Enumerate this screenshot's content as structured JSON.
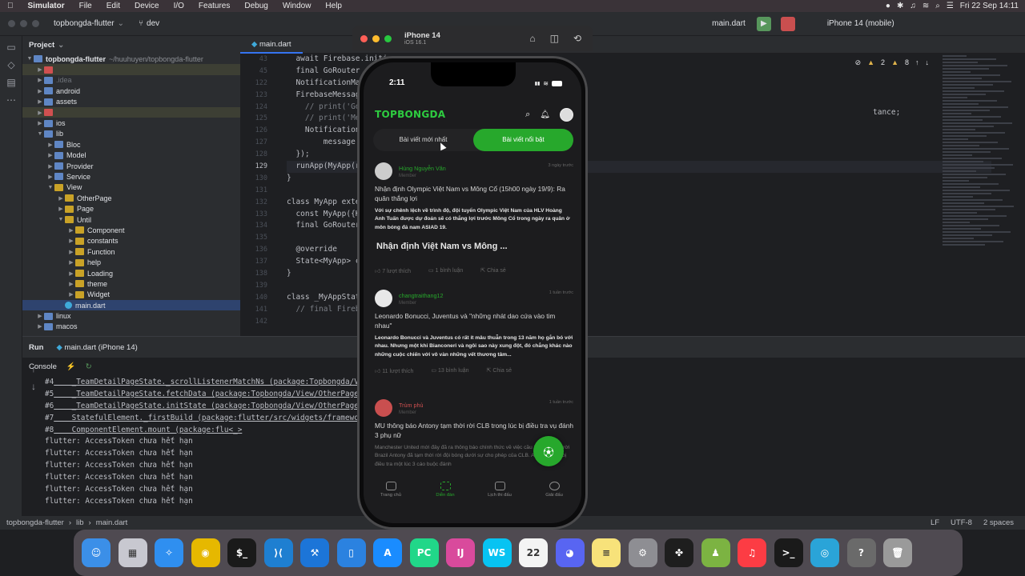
{
  "menubar": {
    "apple": "",
    "app": "Simulator",
    "items": [
      "File",
      "Edit",
      "Device",
      "I/O",
      "Features",
      "Debug",
      "Window",
      "Help"
    ],
    "clock": "Fri 22 Sep  14:11"
  },
  "ide": {
    "project_name": "topbongda-flutter",
    "branch": "dev",
    "run_config": "main.dart",
    "device": "iPhone 14 (mobile)",
    "warnings": "2",
    "weak_warnings": "8"
  },
  "project_panel": {
    "title": "Project",
    "root_label": "topbongda-flutter",
    "root_path": "~/huuhuyen/topbongda-flutter",
    "items": [
      {
        "label": "",
        "level": 1,
        "icon": "red",
        "hl": true
      },
      {
        "label": ".idea",
        "level": 1,
        "icon": "folder",
        "dim": true
      },
      {
        "label": "android",
        "level": 1,
        "icon": "folder"
      },
      {
        "label": "assets",
        "level": 1,
        "icon": "folder"
      },
      {
        "label": "",
        "level": 1,
        "icon": "red",
        "hl": true
      },
      {
        "label": "ios",
        "level": 1,
        "icon": "folder"
      },
      {
        "label": "lib",
        "level": 1,
        "icon": "folder",
        "open": true
      },
      {
        "label": "Bloc",
        "level": 2,
        "icon": "folder"
      },
      {
        "label": "Model",
        "level": 2,
        "icon": "folder"
      },
      {
        "label": "Provider",
        "level": 2,
        "icon": "folder"
      },
      {
        "label": "Service",
        "level": 2,
        "icon": "folder"
      },
      {
        "label": "View",
        "level": 2,
        "icon": "yfolder",
        "open": true
      },
      {
        "label": "OtherPage",
        "level": 3,
        "icon": "yfolder"
      },
      {
        "label": "Page",
        "level": 3,
        "icon": "yfolder"
      },
      {
        "label": "Until",
        "level": 3,
        "icon": "yfolder",
        "open": true
      },
      {
        "label": "Component",
        "level": 4,
        "icon": "yfolder"
      },
      {
        "label": "constants",
        "level": 4,
        "icon": "yfolder"
      },
      {
        "label": "Function",
        "level": 4,
        "icon": "yfolder"
      },
      {
        "label": "help",
        "level": 4,
        "icon": "yfolder"
      },
      {
        "label": "Loading",
        "level": 4,
        "icon": "yfolder"
      },
      {
        "label": "theme",
        "level": 4,
        "icon": "yfolder"
      },
      {
        "label": "Widget",
        "level": 4,
        "icon": "yfolder"
      },
      {
        "label": "main.dart",
        "level": 3,
        "icon": "dart",
        "selected": true
      },
      {
        "label": "linux",
        "level": 1,
        "icon": "folder"
      },
      {
        "label": "macos",
        "level": 1,
        "icon": "folder"
      }
    ]
  },
  "editor": {
    "tab": "main.dart",
    "line_numbers": [
      "43",
      "45",
      "122",
      "123",
      "124",
      "125",
      "126",
      "127",
      "128",
      "129",
      "130",
      "131",
      "132",
      "133",
      "134",
      "135",
      "136",
      "137",
      "138",
      "139",
      "140",
      "141",
      "142"
    ],
    "lines": [
      "  await Firebase.initi",
      "  final GoRouter",
      "  NotificationMan",
      "  FirebaseMessag",
      "    // print('Got",
      "    // print('Mes",
      "    Notification",
      "        message.c",
      "  });",
      "  runApp(MyApp(r",
      "}",
      "",
      "class MyApp exte",
      "  const MyApp({K",
      "  final GoRouter",
      "",
      "  @override",
      "  State<MyApp> cr",
      "}",
      "",
      "class _MyAppState",
      "  // final Fireba",
      ""
    ],
    "right_fragment": "tance;"
  },
  "run_panel": {
    "run_label": "Run",
    "run_tab": "main.dart (iPhone 14)",
    "console_label": "Console",
    "console_lines": [
      {
        "num": "#4",
        "text": "    _TeamDetailPageState._scrollListenerMatchNs (package:Topbongda/Vi"
      },
      {
        "num": "#5",
        "text": "    _TeamDetailPageState.fetchData (package:Topbongda/View/OtherPage."
      },
      {
        "num": "#6",
        "text": "    _TeamDetailPageState.initState (package:Topbongda/View/OtherPage."
      },
      {
        "num": "#7",
        "text": "    StatefulElement._firstBuild (package:flutter/src/widgets/framewo"
      },
      {
        "num": "#8",
        "text": "    ComponentElement.mount (package:flu<_>"
      },
      {
        "num": "",
        "text": "flutter: AccessToken chưa hết hạn"
      },
      {
        "num": "",
        "text": "flutter: AccessToken chưa hết hạn"
      },
      {
        "num": "",
        "text": "flutter: AccessToken chưa hết hạn"
      },
      {
        "num": "",
        "text": "flutter: AccessToken chưa hết hạn"
      },
      {
        "num": "",
        "text": "flutter: AccessToken chưa hết hạn"
      },
      {
        "num": "",
        "text": "flutter: AccessToken chưa hết hạn"
      }
    ]
  },
  "statusbar": {
    "path": [
      "topbongda-flutter",
      "lib",
      "main.dart"
    ],
    "line_sep": "LF",
    "encoding": "UTF-8",
    "indent": "2 spaces"
  },
  "simulator": {
    "device": "iPhone 14",
    "os": "iOS 16.1"
  },
  "phone": {
    "time": "2:11",
    "logo": "TOPBONGDA",
    "tabs": [
      "Bài viết mới nhất",
      "Bài viết nổi bật"
    ],
    "active_tab": 1,
    "posts": [
      {
        "author": "Hùng Nguyễn Văn",
        "role": "Member",
        "time": "3 ngày trước",
        "title": "Nhận định Olympic Việt Nam vs Mông Cổ (15h00 ngày 19/9): Ra quân thắng lợi",
        "excerpt": "Với sự chênh lệch về trình độ, đội tuyển Olympic Việt Nam của HLV Hoàng Anh Tuấn được dự đoán sẽ có thắng lợi trước Mông Cổ trong ngày ra quân ở môn bóng đá nam ASIAD 19.",
        "big": "Nhận định Việt Nam vs Mông ...",
        "likes": "7 lượt thích",
        "comments": "1 bình luận",
        "share": "Chia sẻ"
      },
      {
        "author": "changtraithang12",
        "role": "Member",
        "time": "1 tuần trước",
        "title": "Leonardo Bonucci, Juventus và \"những nhát dao cứa vào tim nhau\"",
        "excerpt": "Leonardo Bonucci và Juventus có rất ít mâu thuẫn trong 13 năm họ gắn bó với nhau. Nhưng một khi Bianconeri và ngôi sao này xung đột, đó chẳng khác nào những cuộc chiến với vô vàn những vết thương tâm...",
        "likes": "11 lượt thích",
        "comments": "13 bình luận",
        "share": "Chia sẻ"
      },
      {
        "author": "Trùm phủ",
        "role": "Member",
        "time": "1 tuần trước",
        "title": "MU thông báo Antony tạm thời rời CLB trong lúc bị điều tra vụ đánh 3 phụ nữ",
        "excerpt": "Manchester United mới đây đã ra thông báo chính thức về việc cầu thủ công người Brazil Antony đã tạm thời rời đội bóng dưới sự cho phép của CLB. Antony đang bị điều tra một lúc 3 cáo buộc đánh"
      }
    ],
    "nav": [
      "Trang chủ",
      "Diễn đàn",
      "Lịch thi đấu",
      "Giải đấu"
    ],
    "active_nav": 1
  },
  "dock": {
    "icons": [
      {
        "name": "finder-icon",
        "glyph": "☺",
        "color": "#3b8fe8"
      },
      {
        "name": "launchpad-icon",
        "glyph": "▦",
        "color": "#c8c8d0"
      },
      {
        "name": "safari-icon",
        "glyph": "✧",
        "color": "#2f8ff0"
      },
      {
        "name": "chrome-icon",
        "glyph": "◉",
        "color": "#e6b800"
      },
      {
        "name": "terminal-icon",
        "glyph": "$_",
        "color": "#1a1a1a"
      },
      {
        "name": "vscode-icon",
        "glyph": "⟩⟨",
        "color": "#1e7fd1"
      },
      {
        "name": "xcode-icon",
        "glyph": "⚒",
        "color": "#1c75d8"
      },
      {
        "name": "simulator-icon",
        "glyph": "▯",
        "color": "#2b82e0"
      },
      {
        "name": "app-store-icon",
        "glyph": "A",
        "color": "#1a8cff"
      },
      {
        "name": "pycharm-icon",
        "glyph": "PC",
        "color": "#21d789"
      },
      {
        "name": "intellij-icon",
        "glyph": "IJ",
        "color": "#d94a9c"
      },
      {
        "name": "webstorm-icon",
        "glyph": "WS",
        "color": "#07c3f2"
      },
      {
        "name": "calendar-icon",
        "glyph": "22",
        "color": "#f4f4f4"
      },
      {
        "name": "discord-icon",
        "glyph": "◕",
        "color": "#5865f2"
      },
      {
        "name": "notes-icon",
        "glyph": "≡",
        "color": "#f7e27a"
      },
      {
        "name": "system-settings-icon",
        "glyph": "⚙",
        "color": "#8e8e93"
      },
      {
        "name": "figma-icon",
        "glyph": "✤",
        "color": "#1e1e1e"
      },
      {
        "name": "android-icon",
        "glyph": "♟",
        "color": "#7cb342"
      },
      {
        "name": "music-icon",
        "glyph": "♫",
        "color": "#fc3c44"
      },
      {
        "name": "terminal2-icon",
        "glyph": ">_",
        "color": "#1a1a1a"
      },
      {
        "name": "edge-icon",
        "glyph": "◎",
        "color": "#2aa4d8"
      },
      {
        "name": "help-icon",
        "glyph": "?",
        "color": "#6a6a6a"
      },
      {
        "name": "trash-icon",
        "glyph": "🗑",
        "color": "#9a9a9a"
      }
    ],
    "calendar_month": "SEP"
  }
}
